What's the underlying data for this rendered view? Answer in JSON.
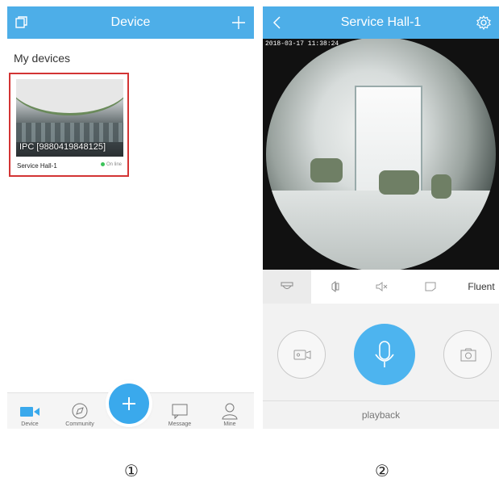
{
  "screen1": {
    "header": {
      "title": "Device",
      "left_icon": "copy-icon",
      "right_icon": "plus-icon"
    },
    "section_title": "My devices",
    "device_card": {
      "overlay_label": "IPC [9880419848125]",
      "name": "Service Hall-1",
      "status": "On line",
      "status_color": "#3cc35a",
      "border_color": "#d33434"
    },
    "bottom_nav": [
      {
        "label": "Device",
        "icon": "video-camera-icon"
      },
      {
        "label": "Community",
        "icon": "compass-icon"
      },
      {
        "label": "Message",
        "icon": "message-icon"
      },
      {
        "label": "Mine",
        "icon": "person-icon"
      }
    ],
    "fab_icon": "plus-icon"
  },
  "screen2": {
    "header": {
      "title": "Service Hall-1",
      "left_icon": "back-chevron-icon",
      "right_icon": "gear-icon"
    },
    "timestamp": "2018-03-17  11:38:24",
    "toolbar": {
      "items": [
        "camera-mount-icon",
        "speaker-icon",
        "mute-icon",
        "screen-icon"
      ],
      "quality": "Fluent"
    },
    "controls": {
      "left": "record-icon",
      "center": "microphone-icon",
      "right": "snapshot-icon"
    },
    "playback_label": "playback"
  },
  "markers": [
    "①",
    "②"
  ],
  "colors": {
    "accent": "#4daee8",
    "fab": "#3aa9ec",
    "mic": "#4db4ef"
  }
}
